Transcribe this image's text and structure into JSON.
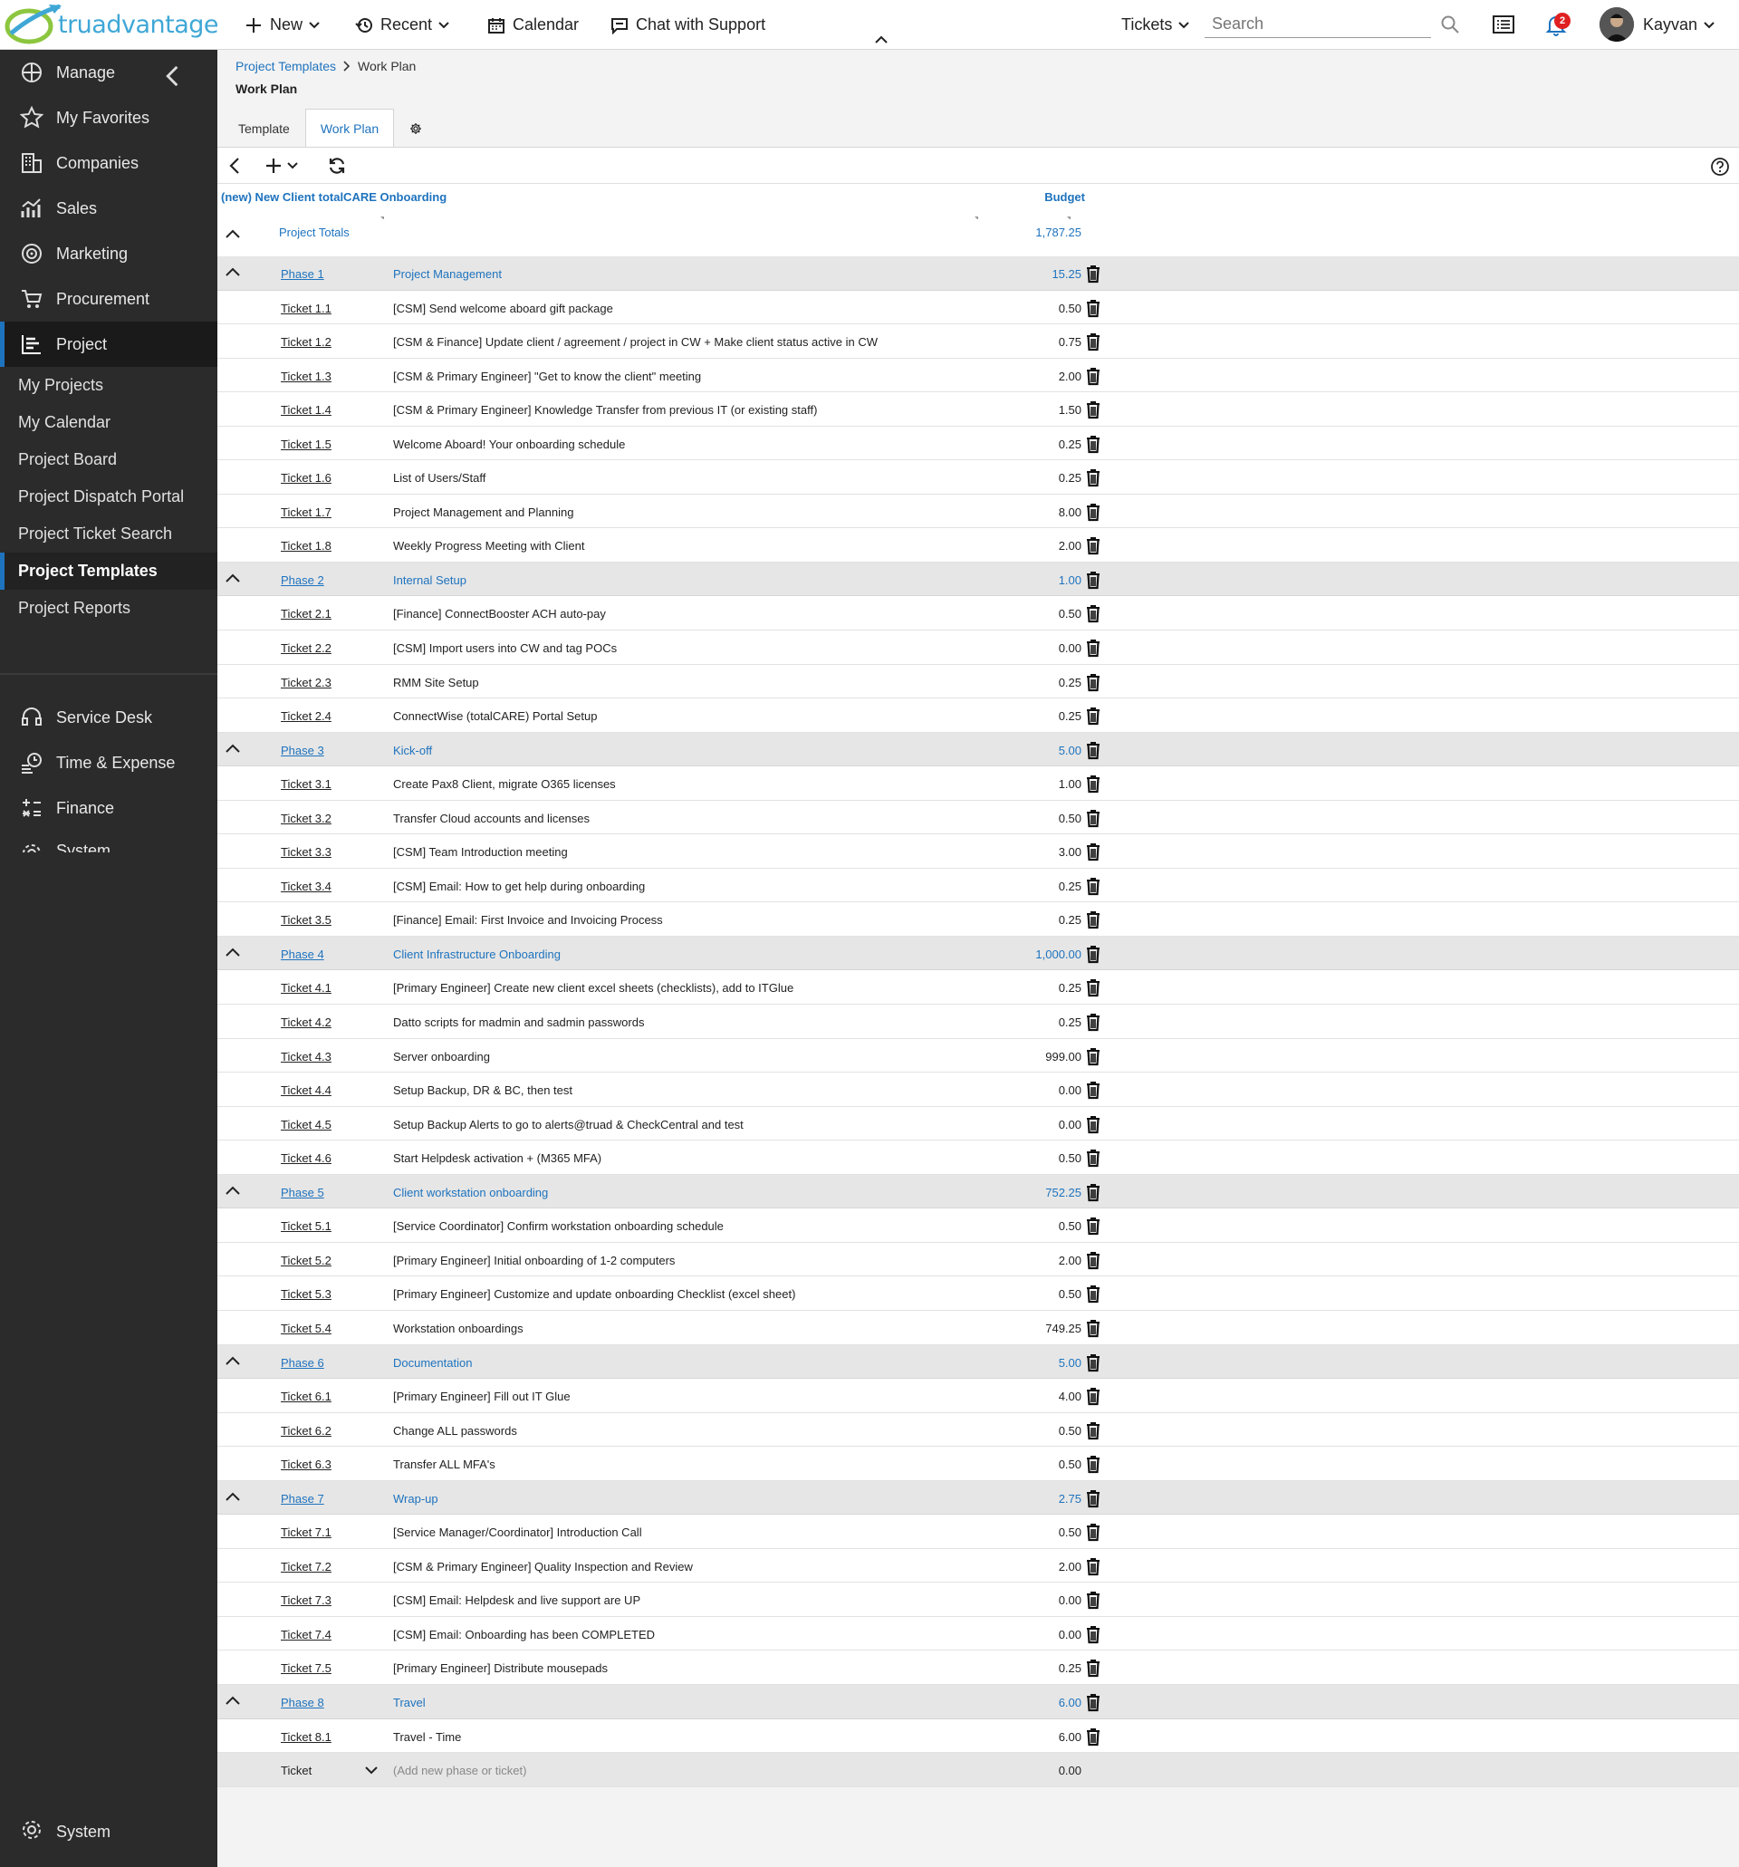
{
  "app": {
    "logo_text": "truadvantage"
  },
  "topbar": {
    "new_label": "New",
    "recent_label": "Recent",
    "calendar_label": "Calendar",
    "chat_label": "Chat with Support",
    "tickets_label": "Tickets",
    "search_placeholder": "Search",
    "notification_count": "2",
    "user_name": "Kayvan"
  },
  "sidebar": {
    "items": [
      {
        "label": "Manage"
      },
      {
        "label": "My Favorites"
      },
      {
        "label": "Companies"
      },
      {
        "label": "Sales"
      },
      {
        "label": "Marketing"
      },
      {
        "label": "Procurement"
      },
      {
        "label": "Project"
      }
    ],
    "sub_items": [
      {
        "label": "My Projects"
      },
      {
        "label": "My Calendar"
      },
      {
        "label": "Project Board"
      },
      {
        "label": "Project Dispatch Portal"
      },
      {
        "label": "Project Ticket Search"
      },
      {
        "label": "Project Templates"
      },
      {
        "label": "Project Reports"
      }
    ],
    "lower_items": [
      {
        "label": "Service Desk"
      },
      {
        "label": "Time & Expense"
      },
      {
        "label": "Finance"
      },
      {
        "label": "System"
      }
    ],
    "bottom_label": "System"
  },
  "breadcrumb": {
    "link": "Project Templates",
    "current": "Work Plan"
  },
  "page_title": "Work Plan",
  "tabs": {
    "template": "Template",
    "work_plan": "Work Plan"
  },
  "workplan": {
    "project_name": "(new) New Client totalCARE Onboarding",
    "budget_header": "Budget",
    "totals_label": "Project Totals",
    "totals_value": "1,787.25",
    "add_row": {
      "type": "Ticket",
      "placeholder": "(Add new phase or ticket)",
      "budget": "0.00"
    },
    "rows": [
      {
        "kind": "phase",
        "id": "Phase 1",
        "desc": "Project Management",
        "budget": "15.25"
      },
      {
        "kind": "ticket",
        "id": "Ticket 1.1",
        "desc": "[CSM] Send welcome aboard gift package",
        "budget": "0.50"
      },
      {
        "kind": "ticket",
        "id": "Ticket 1.2",
        "desc": "[CSM & Finance] Update client / agreement / project in CW + Make client status active in CW",
        "budget": "0.75"
      },
      {
        "kind": "ticket",
        "id": "Ticket 1.3",
        "desc": "[CSM & Primary Engineer] \"Get to know the client\" meeting",
        "budget": "2.00"
      },
      {
        "kind": "ticket",
        "id": "Ticket 1.4",
        "desc": "[CSM & Primary Engineer] Knowledge Transfer from previous IT (or existing staff)",
        "budget": "1.50"
      },
      {
        "kind": "ticket",
        "id": "Ticket 1.5",
        "desc": "Welcome Aboard! Your onboarding schedule",
        "budget": "0.25"
      },
      {
        "kind": "ticket",
        "id": "Ticket 1.6",
        "desc": "List of Users/Staff",
        "budget": "0.25"
      },
      {
        "kind": "ticket",
        "id": "Ticket 1.7",
        "desc": "Project Management and Planning",
        "budget": "8.00"
      },
      {
        "kind": "ticket",
        "id": "Ticket 1.8",
        "desc": "Weekly Progress Meeting with Client",
        "budget": "2.00"
      },
      {
        "kind": "phase",
        "id": "Phase 2",
        "desc": "Internal Setup",
        "budget": "1.00"
      },
      {
        "kind": "ticket",
        "id": "Ticket 2.1",
        "desc": "[Finance] ConnectBooster ACH auto-pay",
        "budget": "0.50"
      },
      {
        "kind": "ticket",
        "id": "Ticket 2.2",
        "desc": "[CSM] Import users into CW and tag POCs",
        "budget": "0.00"
      },
      {
        "kind": "ticket",
        "id": "Ticket 2.3",
        "desc": "RMM Site Setup",
        "budget": "0.25"
      },
      {
        "kind": "ticket",
        "id": "Ticket 2.4",
        "desc": "ConnectWise (totalCARE) Portal Setup",
        "budget": "0.25"
      },
      {
        "kind": "phase",
        "id": "Phase 3",
        "desc": "Kick-off",
        "budget": "5.00"
      },
      {
        "kind": "ticket",
        "id": "Ticket 3.1",
        "desc": "Create Pax8 Client, migrate O365 licenses",
        "budget": "1.00"
      },
      {
        "kind": "ticket",
        "id": "Ticket 3.2",
        "desc": "Transfer Cloud accounts and licenses",
        "budget": "0.50"
      },
      {
        "kind": "ticket",
        "id": "Ticket 3.3",
        "desc": "[CSM] Team Introduction meeting",
        "budget": "3.00"
      },
      {
        "kind": "ticket",
        "id": "Ticket 3.4",
        "desc": "[CSM] Email: How to get help during onboarding",
        "budget": "0.25"
      },
      {
        "kind": "ticket",
        "id": "Ticket 3.5",
        "desc": "[Finance] Email: First Invoice and Invoicing Process",
        "budget": "0.25"
      },
      {
        "kind": "phase",
        "id": "Phase 4",
        "desc": "Client Infrastructure Onboarding",
        "budget": "1,000.00"
      },
      {
        "kind": "ticket",
        "id": "Ticket 4.1",
        "desc": "[Primary Engineer] Create new client excel sheets (checklists), add to ITGlue",
        "budget": "0.25"
      },
      {
        "kind": "ticket",
        "id": "Ticket 4.2",
        "desc": "Datto scripts for madmin and sadmin passwords",
        "budget": "0.25"
      },
      {
        "kind": "ticket",
        "id": "Ticket 4.3",
        "desc": "Server onboarding",
        "budget": "999.00"
      },
      {
        "kind": "ticket",
        "id": "Ticket 4.4",
        "desc": "Setup Backup, DR & BC, then test",
        "budget": "0.00"
      },
      {
        "kind": "ticket",
        "id": "Ticket 4.5",
        "desc": "Setup Backup Alerts to go to alerts@truad & CheckCentral and test",
        "budget": "0.00"
      },
      {
        "kind": "ticket",
        "id": "Ticket 4.6",
        "desc": "Start Helpdesk activation + (M365 MFA)",
        "budget": "0.50"
      },
      {
        "kind": "phase",
        "id": "Phase 5",
        "desc": "Client workstation onboarding",
        "budget": "752.25"
      },
      {
        "kind": "ticket",
        "id": "Ticket 5.1",
        "desc": "[Service Coordinator] Confirm workstation onboarding schedule",
        "budget": "0.50"
      },
      {
        "kind": "ticket",
        "id": "Ticket 5.2",
        "desc": "[Primary Engineer] Initial onboarding of 1-2 computers",
        "budget": "2.00"
      },
      {
        "kind": "ticket",
        "id": "Ticket 5.3",
        "desc": "[Primary Engineer] Customize and update onboarding Checklist (excel sheet)",
        "budget": "0.50"
      },
      {
        "kind": "ticket",
        "id": "Ticket 5.4",
        "desc": "Workstation onboardings",
        "budget": "749.25"
      },
      {
        "kind": "phase",
        "id": "Phase 6",
        "desc": "Documentation",
        "budget": "5.00"
      },
      {
        "kind": "ticket",
        "id": "Ticket 6.1",
        "desc": "[Primary Engineer] Fill out IT Glue",
        "budget": "4.00"
      },
      {
        "kind": "ticket",
        "id": "Ticket 6.2",
        "desc": "Change ALL passwords",
        "budget": "0.50"
      },
      {
        "kind": "ticket",
        "id": "Ticket 6.3",
        "desc": "Transfer ALL MFA's",
        "budget": "0.50"
      },
      {
        "kind": "phase",
        "id": "Phase 7",
        "desc": "Wrap-up",
        "budget": "2.75"
      },
      {
        "kind": "ticket",
        "id": "Ticket 7.1",
        "desc": "[Service Manager/Coordinator] Introduction Call",
        "budget": "0.50"
      },
      {
        "kind": "ticket",
        "id": "Ticket 7.2",
        "desc": "[CSM & Primary Engineer] Quality Inspection and Review",
        "budget": "2.00"
      },
      {
        "kind": "ticket",
        "id": "Ticket 7.3",
        "desc": "[CSM] Email: Helpdesk and live support are UP",
        "budget": "0.00"
      },
      {
        "kind": "ticket",
        "id": "Ticket 7.4",
        "desc": "[CSM] Email: Onboarding has been COMPLETED",
        "budget": "0.00"
      },
      {
        "kind": "ticket",
        "id": "Ticket 7.5",
        "desc": "[Primary Engineer] Distribute mousepads",
        "budget": "0.25"
      },
      {
        "kind": "phase",
        "id": "Phase 8",
        "desc": "Travel",
        "budget": "6.00"
      },
      {
        "kind": "ticket",
        "id": "Ticket 8.1",
        "desc": "Travel - Time",
        "budget": "6.00"
      }
    ]
  },
  "colors": {
    "accent": "#1e73be",
    "sidebar_bg": "#2b2b2b",
    "phase_row_bg": "#e6e6e6",
    "badge": "#e02020"
  }
}
